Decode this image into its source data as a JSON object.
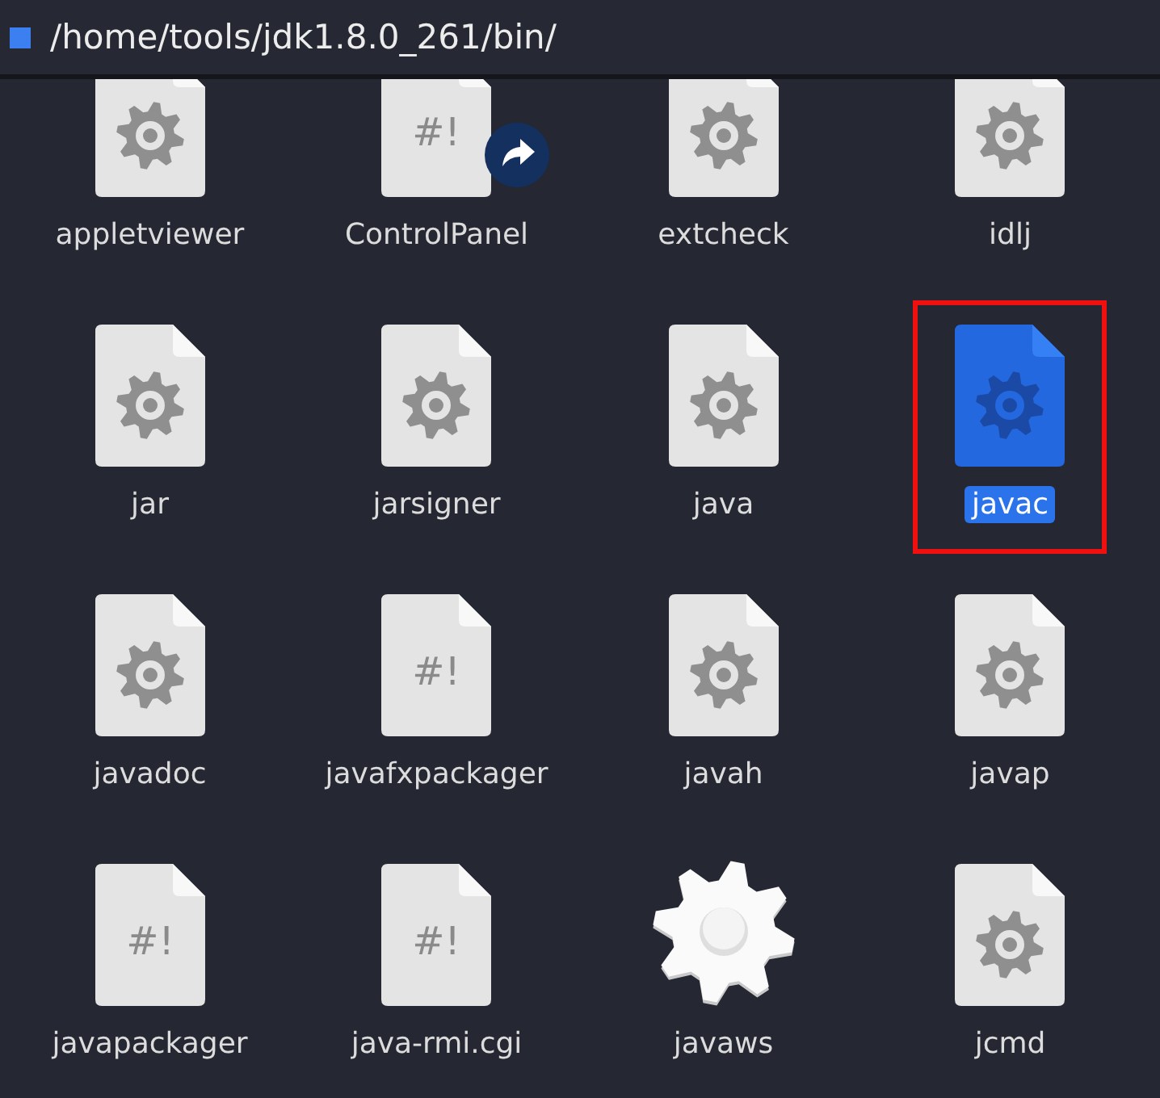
{
  "path_bar": {
    "path": "/home/tools/jdk1.8.0_261/bin/"
  },
  "files": [
    {
      "name": "appletviewer",
      "kind": "gear",
      "selected": false,
      "highlighted": false,
      "link": false
    },
    {
      "name": "ControlPanel",
      "kind": "script",
      "glyph": "#!",
      "selected": false,
      "highlighted": false,
      "link": true
    },
    {
      "name": "extcheck",
      "kind": "gear",
      "selected": false,
      "highlighted": false,
      "link": false
    },
    {
      "name": "idlj",
      "kind": "gear",
      "selected": false,
      "highlighted": false,
      "link": false
    },
    {
      "name": "jar",
      "kind": "gear",
      "selected": false,
      "highlighted": false,
      "link": false
    },
    {
      "name": "jarsigner",
      "kind": "gear",
      "selected": false,
      "highlighted": false,
      "link": false
    },
    {
      "name": "java",
      "kind": "gear",
      "selected": false,
      "highlighted": false,
      "link": false
    },
    {
      "name": "javac",
      "kind": "gear",
      "selected": true,
      "highlighted": true,
      "link": false
    },
    {
      "name": "javadoc",
      "kind": "gear",
      "selected": false,
      "highlighted": false,
      "link": false
    },
    {
      "name": "javafxpackager",
      "kind": "script",
      "glyph": "#!",
      "selected": false,
      "highlighted": false,
      "link": false
    },
    {
      "name": "javah",
      "kind": "gear",
      "selected": false,
      "highlighted": false,
      "link": false
    },
    {
      "name": "javap",
      "kind": "gear",
      "selected": false,
      "highlighted": false,
      "link": false
    },
    {
      "name": "javapackager",
      "kind": "script",
      "glyph": "#!",
      "selected": false,
      "highlighted": false,
      "link": false
    },
    {
      "name": "java-rmi.cgi",
      "kind": "script",
      "glyph": "#!",
      "selected": false,
      "highlighted": false,
      "link": false
    },
    {
      "name": "javaws",
      "kind": "executable",
      "selected": false,
      "highlighted": false,
      "link": false
    },
    {
      "name": "jcmd",
      "kind": "gear",
      "selected": false,
      "highlighted": false,
      "link": false
    }
  ]
}
